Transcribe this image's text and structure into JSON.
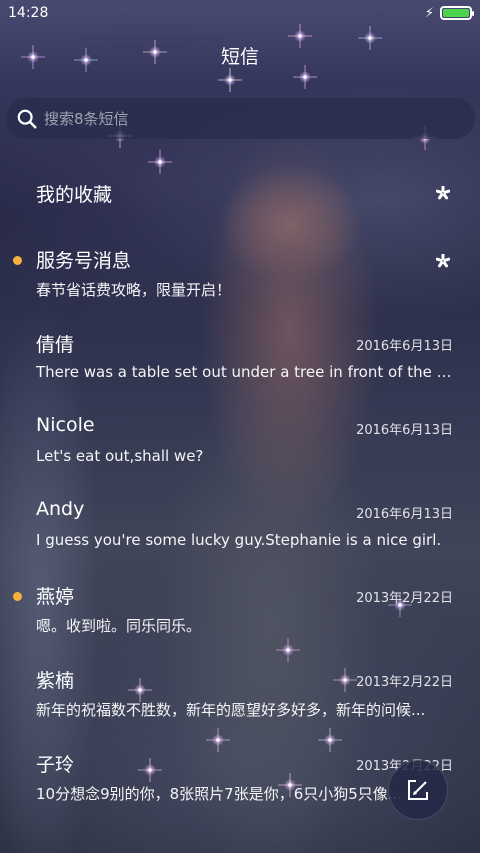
{
  "status_bar": {
    "time": "14:28",
    "battery_level": 1.0,
    "charging": true
  },
  "header": {
    "title": "短信"
  },
  "search": {
    "placeholder": "搜索8条短信"
  },
  "conversations": [
    {
      "name": "我的收藏",
      "preview": "",
      "date": "",
      "unread": false,
      "pinned": true
    },
    {
      "name": "服务号消息",
      "preview": "春节省话费攻略，限量开启！",
      "date": "",
      "unread": true,
      "pinned": true
    },
    {
      "name": "倩倩",
      "preview": "There was a table set out under a tree in front of the ho...",
      "date": "2016年6月13日",
      "unread": false,
      "pinned": false
    },
    {
      "name": "Nicole",
      "preview": "Let's eat out,shall we?",
      "date": "2016年6月13日",
      "unread": false,
      "pinned": false
    },
    {
      "name": "Andy",
      "preview": "I guess you're some lucky guy.Stephanie is a nice girl.",
      "date": "2016年6月13日",
      "unread": false,
      "pinned": false
    },
    {
      "name": "燕婷",
      "preview": "嗯。收到啦。同乐同乐。",
      "date": "2013年2月22日",
      "unread": true,
      "pinned": false
    },
    {
      "name": "紫楠",
      "preview": "新年的祝福数不胜数，新年的愿望好多好多，新年的问候...",
      "date": "2013年2月22日",
      "unread": false,
      "pinned": false
    },
    {
      "name": "子玲",
      "preview": "10分想念9别的你，8张照片7张是你，6只小狗5只像...",
      "date": "2013年2月22日",
      "unread": false,
      "pinned": false
    }
  ],
  "colors": {
    "unread_dot": "#f6b13c",
    "battery": "#4cd44c"
  },
  "icons": {
    "search": "search-icon",
    "pin": "pin-icon",
    "compose": "compose-icon",
    "charging": "charging-icon"
  }
}
